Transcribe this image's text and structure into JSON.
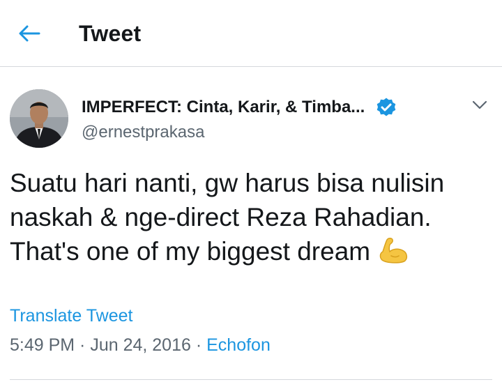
{
  "header": {
    "title": "Tweet",
    "back_icon": "arrow-left-icon",
    "accent_color": "#1b95e0"
  },
  "tweet": {
    "author": {
      "display_name": "IMPERFECT: Cinta, Karir, & Timba...",
      "handle": "@ernestprakasa",
      "verified": true,
      "verified_icon": "verified-badge-icon"
    },
    "more_icon": "chevron-down-icon",
    "text_lines": [
      "Suatu hari nanti, gw harus bisa nulisin",
      "naskah & nge-direct Reza Rahadian.",
      "That's one of my biggest dream"
    ],
    "emoji": "flexed-biceps-icon",
    "translate_label": "Translate Tweet",
    "time": "5:49 PM",
    "date": "Jun 24, 2016",
    "separator": " · ",
    "source": "Echofon"
  }
}
